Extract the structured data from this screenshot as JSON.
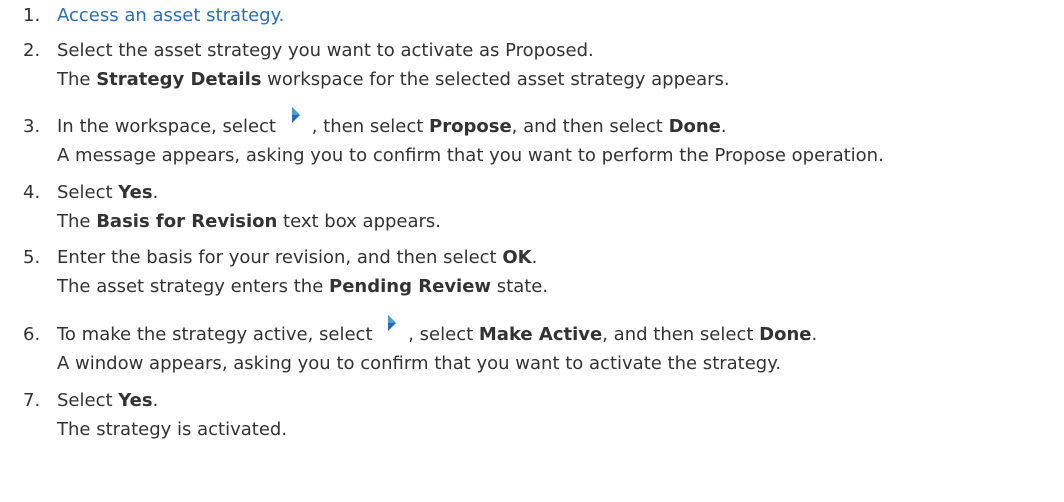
{
  "steps": [
    {
      "num": "1.",
      "link": "Access an asset strategy."
    },
    {
      "num": "2.",
      "text": "Select the asset strategy you want to activate as Proposed.",
      "result_pre": "The ",
      "result_bold": "Strategy Details",
      "result_post": " workspace for the selected asset strategy appears."
    },
    {
      "num": "3.",
      "t1": "In the workspace, select ",
      "t2": ", then select ",
      "b1": "Propose",
      "t3": ", and then select ",
      "b2": "Done",
      "t4": ".",
      "result": "A message appears, asking you to confirm that you want to perform the Propose operation."
    },
    {
      "num": "4.",
      "t1": "Select ",
      "b1": "Yes",
      "t2": ".",
      "result_pre": "The ",
      "result_bold": "Basis for Revision",
      "result_post": " text box appears."
    },
    {
      "num": "5.",
      "t1": "Enter the basis for your revision, and then select ",
      "b1": "OK",
      "t2": ".",
      "result_pre": "The asset strategy enters the ",
      "result_bold": "Pending Review",
      "result_post": " state."
    },
    {
      "num": "6.",
      "t1": "To make the strategy active, select ",
      "t2": ", select ",
      "b1": "Make Active",
      "t3": ", and then select ",
      "b2": "Done",
      "t4": ".",
      "result": "A window appears, asking you to confirm that you want to activate the strategy."
    },
    {
      "num": "7.",
      "t1": "Select ",
      "b1": "Yes",
      "t2": ".",
      "result": "The strategy is activated."
    }
  ],
  "icon": {
    "name": "right-arrow-icon",
    "color": "#1e6fb8"
  },
  "colors": {
    "link": "#2a6ebb",
    "text": "#333333"
  }
}
